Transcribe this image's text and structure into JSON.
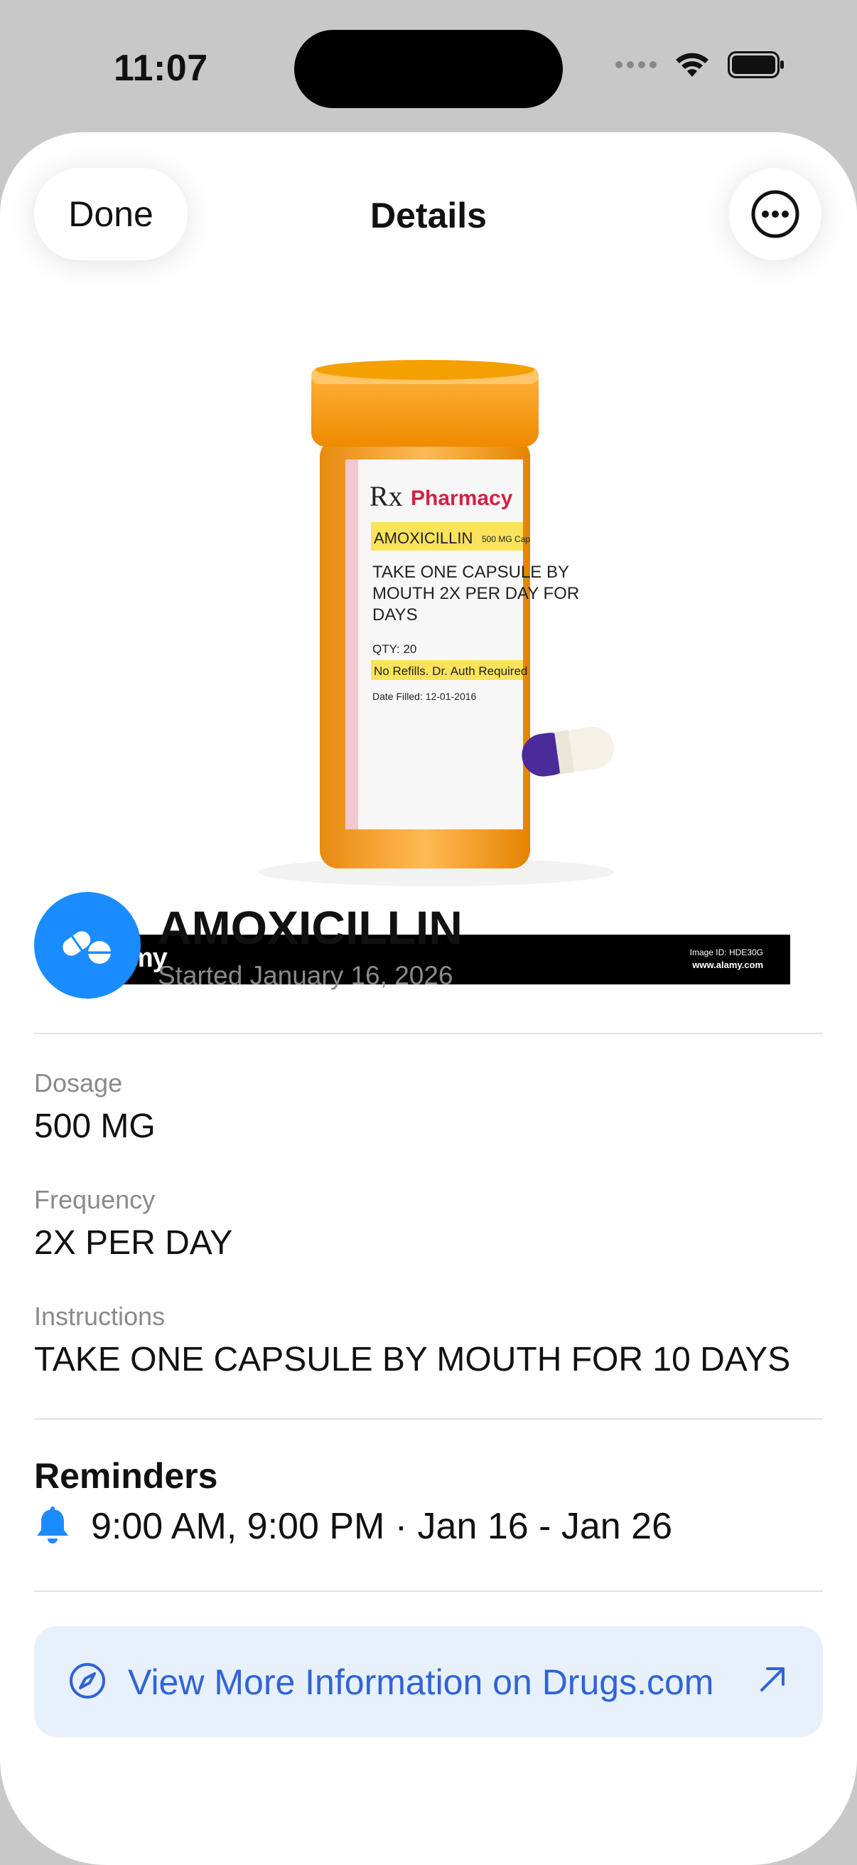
{
  "status_bar": {
    "time": "11:07"
  },
  "nav": {
    "done_label": "Done",
    "title": "Details"
  },
  "photo": {
    "logo": "alamy",
    "image_id": "Image ID: HDE30G",
    "site": "www.alamy.com",
    "label_brand": "Pharmacy",
    "label_rx": "Rx",
    "label_drug": "AMOXICILLIN",
    "label_strength": "500 MG Cap",
    "label_line1": "TAKE ONE CAPSULE BY",
    "label_line2": "MOUTH 2X PER DAY FOR",
    "label_line3": "DAYS",
    "label_qty": "QTY: 20",
    "label_refills": "No Refills.  Dr. Auth Required",
    "label_date": "Date Filled: 12-01-2016"
  },
  "medication": {
    "name": "AMOXICILLIN",
    "started": "Started January 16, 2026",
    "icon": "pills-icon",
    "icon_color": "#1a8cff"
  },
  "fields": [
    {
      "label": "Dosage",
      "value": "500 MG"
    },
    {
      "label": "Frequency",
      "value": "2X PER DAY"
    },
    {
      "label": "Instructions",
      "value": "TAKE ONE CAPSULE BY MOUTH FOR 10 DAYS"
    }
  ],
  "reminders": {
    "title": "Reminders",
    "summary": "9:00 AM, 9:00 PM · Jan 16 - Jan 26",
    "icon": "bell-icon",
    "icon_color": "#1a8cff"
  },
  "link": {
    "label": "View More Information on Drugs.com",
    "color": "#2f64d6",
    "background": "#e7f0fb"
  }
}
